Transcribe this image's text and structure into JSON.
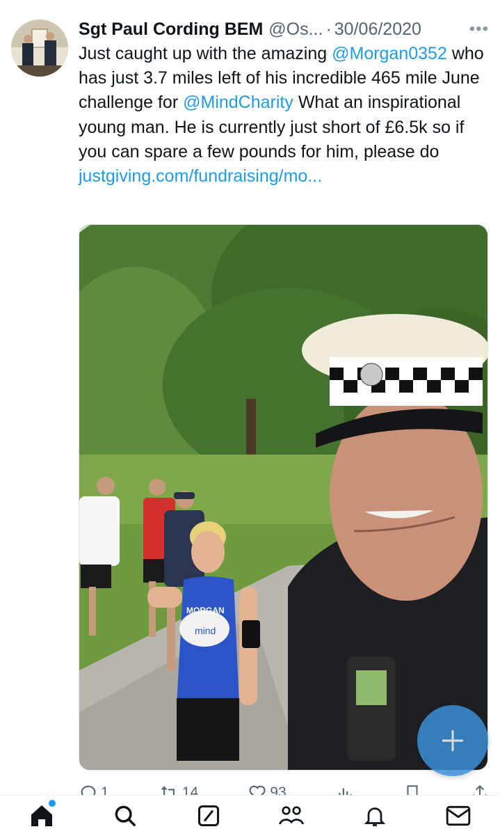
{
  "tweet": {
    "author_name": "Sgt Paul Cording BEM",
    "author_handle": "@Os...",
    "separator": "·",
    "date": "30/06/2020",
    "more_label": "•••",
    "text_parts": {
      "t1": "Just caught up with the amazing ",
      "mention1": "@Morgan0352",
      "t2": " who has just 3.7 miles left of his incredible 465 mile June challenge for ",
      "mention2": "@MindCharity",
      "t3": " What an inspirational young man. He is currently just short of £6.5k so if you can spare a few pounds for him, please do ",
      "link": "justgiving.com/fundraising/mo..."
    },
    "vest_text": {
      "line1": "MORGAN",
      "line2": "mind"
    }
  },
  "actions": {
    "replies": "1",
    "retweets": "14",
    "likes": "93"
  },
  "colors": {
    "accent": "#1d9bf0",
    "text": "#0f1419",
    "muted": "#536471",
    "fab": "#3b8ed6"
  },
  "nav": {
    "items": [
      "home-icon",
      "search-icon",
      "grok-icon",
      "communities-icon",
      "notifications-icon",
      "messages-icon"
    ]
  }
}
